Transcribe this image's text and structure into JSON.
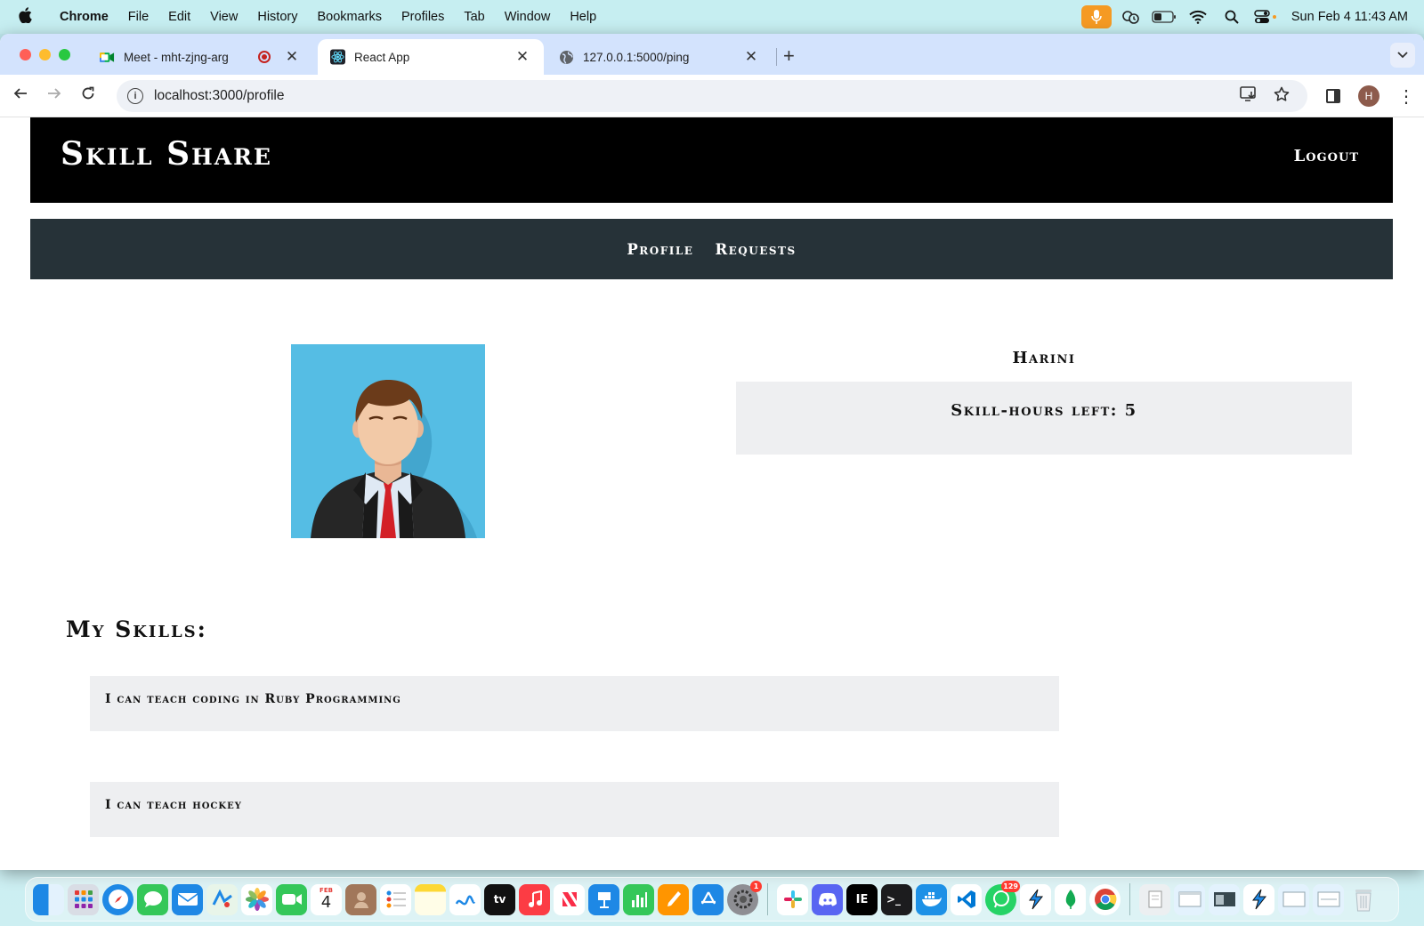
{
  "menubar": {
    "app_name": "Chrome",
    "items": [
      "File",
      "Edit",
      "View",
      "History",
      "Bookmarks",
      "Profiles",
      "Tab",
      "Window",
      "Help"
    ],
    "clock": "Sun Feb 4  11:43 AM"
  },
  "browser": {
    "tabs": [
      {
        "title": "Meet - mht-zjng-arg",
        "icon": "google-meet-icon"
      },
      {
        "title": "React App",
        "icon": "react-icon",
        "active": true
      },
      {
        "title": "127.0.0.1:5000/ping",
        "icon": "globe-icon"
      }
    ],
    "url": "localhost:3000/profile",
    "profile_initial": "H"
  },
  "app": {
    "title": "Skill Share",
    "logout_label": "Logout",
    "nav": {
      "profile": "Profile",
      "requests": "Requests"
    },
    "user_name": "Harini",
    "skill_hours_label": "Skill-hours left: 5",
    "skills_heading": "My Skills:",
    "skills": [
      "I can teach coding in Ruby Programming",
      "I can teach hockey"
    ]
  },
  "dock": {
    "calendar_day": "4",
    "calendar_month": "FEB",
    "settings_badge": "1",
    "whatsapp_badge": "129"
  },
  "colors": {
    "header_bg": "#000000",
    "nav_bg": "#263238",
    "card_bg": "#eeeff1",
    "photo_bg": "#55bde4"
  }
}
